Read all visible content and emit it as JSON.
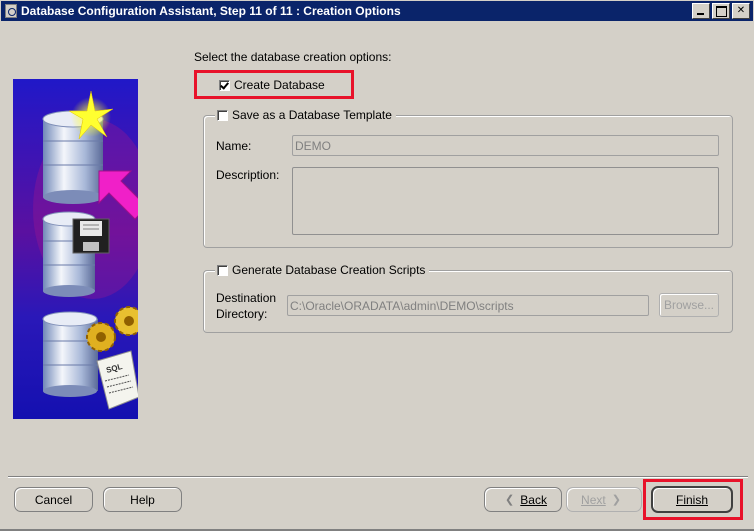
{
  "window": {
    "title": "Database Configuration Assistant, Step 11 of 11 : Creation Options"
  },
  "heading": "Select the database creation options:",
  "options": {
    "create_database": {
      "label": "Create Database",
      "checked": true
    },
    "save_template": {
      "label": "Save as a Database Template",
      "checked": false
    },
    "generate_scripts": {
      "label": "Generate Database Creation Scripts",
      "checked": false
    }
  },
  "template_group": {
    "name_label": "Name:",
    "name_value": "DEMO",
    "description_label": "Description:",
    "description_value": ""
  },
  "scripts_group": {
    "destination_label_line1": "Destination",
    "destination_label_line2": "Directory:",
    "destination_value": "C:\\Oracle\\ORADATA\\admin\\DEMO\\scripts",
    "browse_label": "Browse..."
  },
  "buttons": {
    "cancel": "Cancel",
    "help": "Help",
    "back": "Back",
    "next": "Next",
    "finish": "Finish"
  },
  "colors": {
    "highlight": "#e8122a",
    "titlebar": "#0a246a",
    "window_bg": "#d4d0c8"
  },
  "icons": {
    "side_image": "database-creation-illustration"
  }
}
